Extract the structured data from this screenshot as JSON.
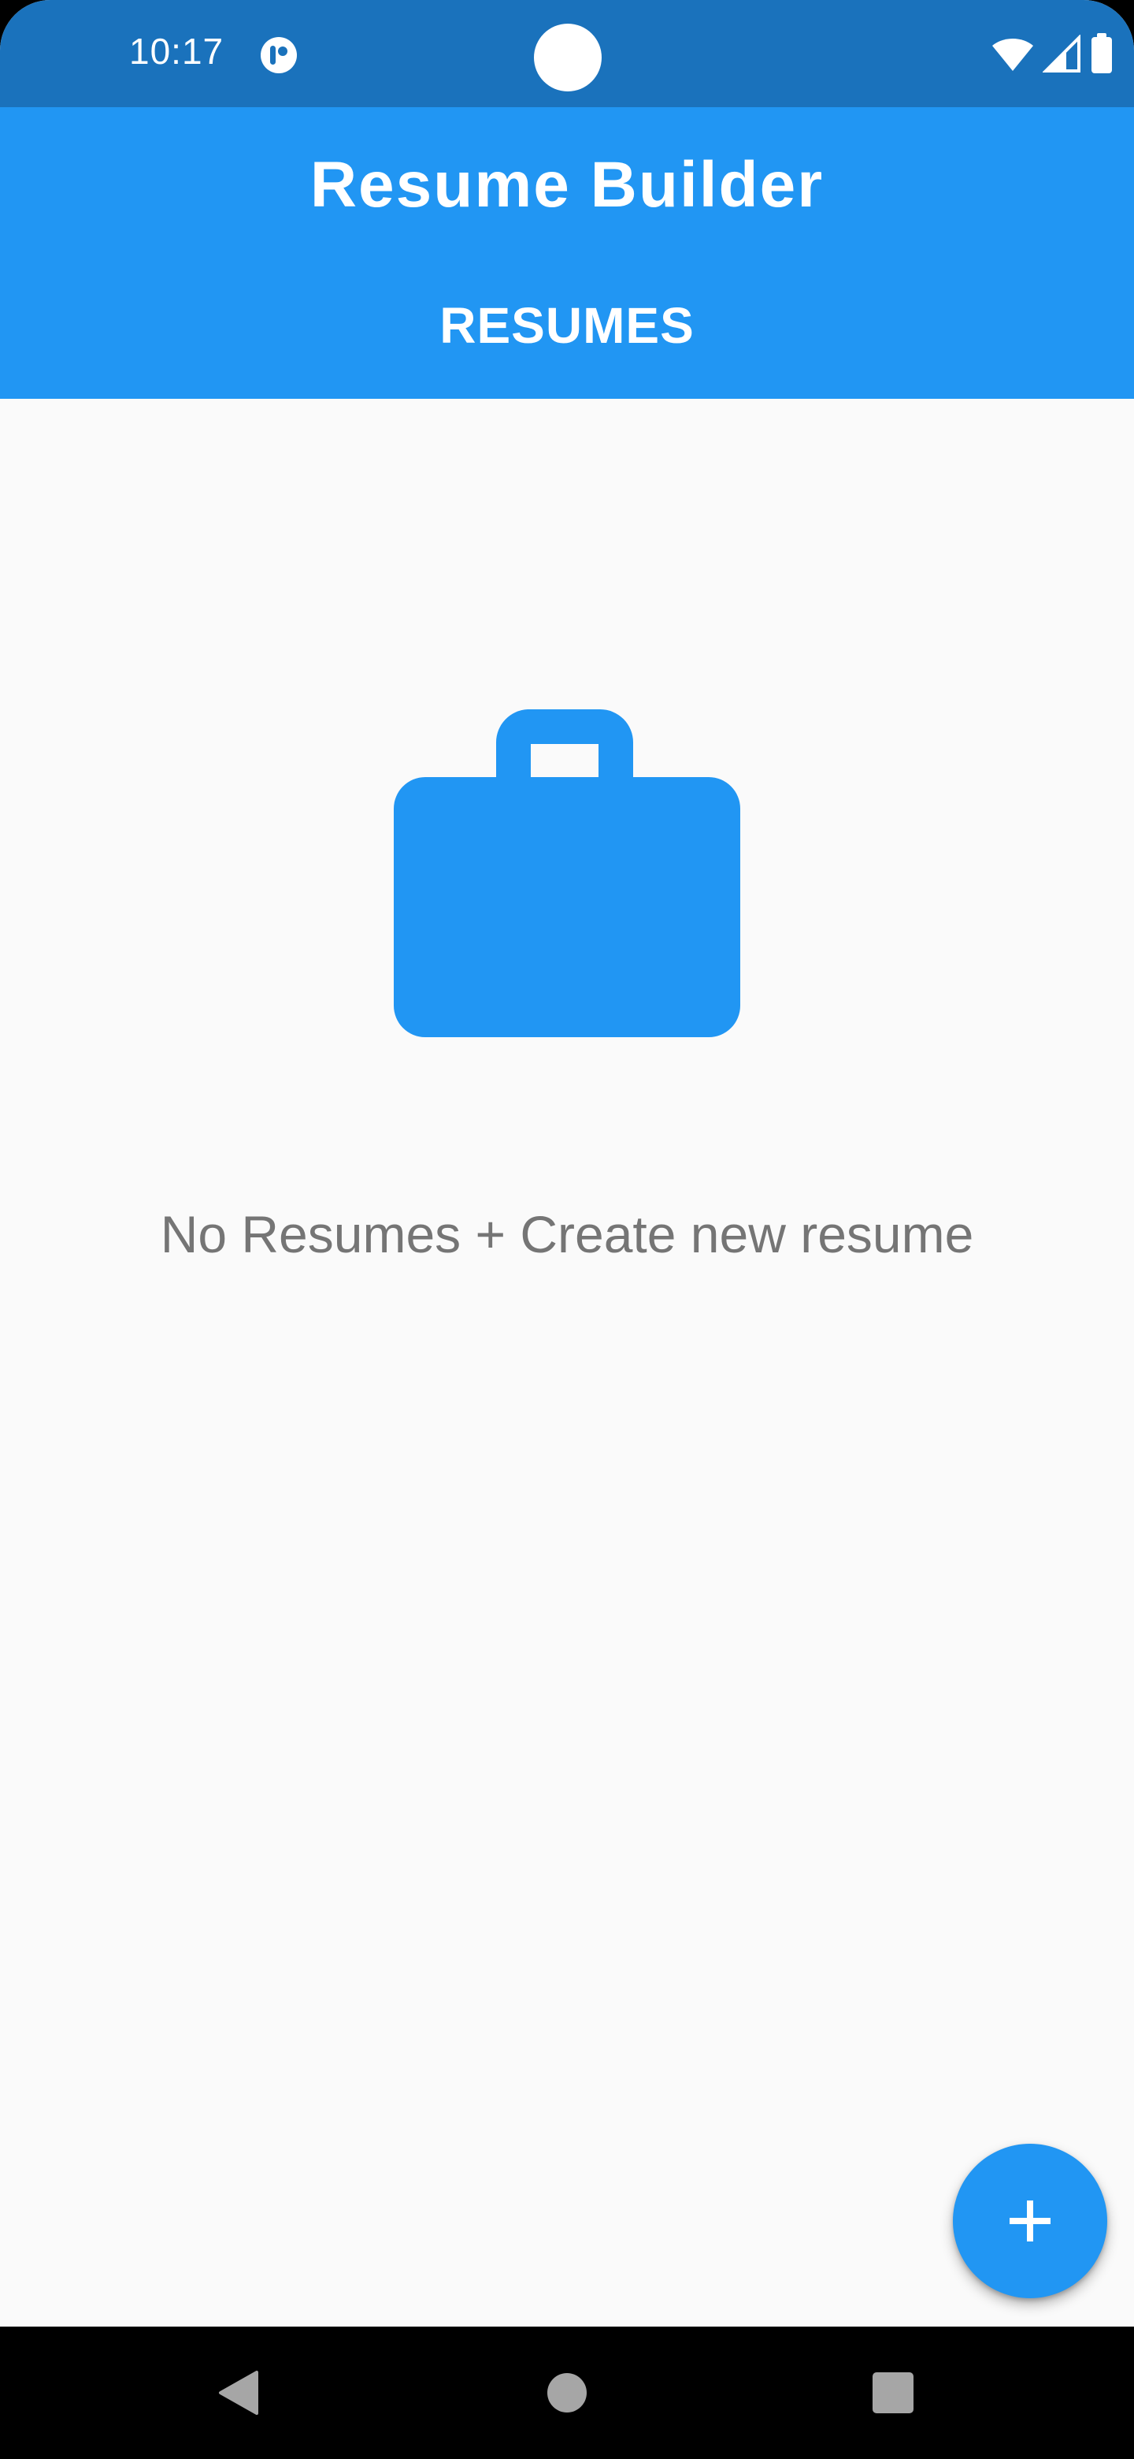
{
  "status_bar": {
    "time": "10:17",
    "app_icon": "notification-app-icon",
    "icons": [
      "wifi-icon",
      "signal-icon",
      "battery-icon"
    ]
  },
  "app_bar": {
    "title": "Resume Builder",
    "tab_label": "RESUMES"
  },
  "empty_state": {
    "icon": "briefcase-icon",
    "message": "No Resumes + Create new resume"
  },
  "fab": {
    "icon": "add-icon",
    "label": "+"
  },
  "nav_bar": {
    "buttons": [
      "back-icon",
      "home-icon",
      "recents-icon"
    ]
  },
  "colors": {
    "primary": "#2196f3",
    "status_bar": "#1a72bc",
    "background": "#fafafa",
    "text_secondary": "#757575"
  }
}
